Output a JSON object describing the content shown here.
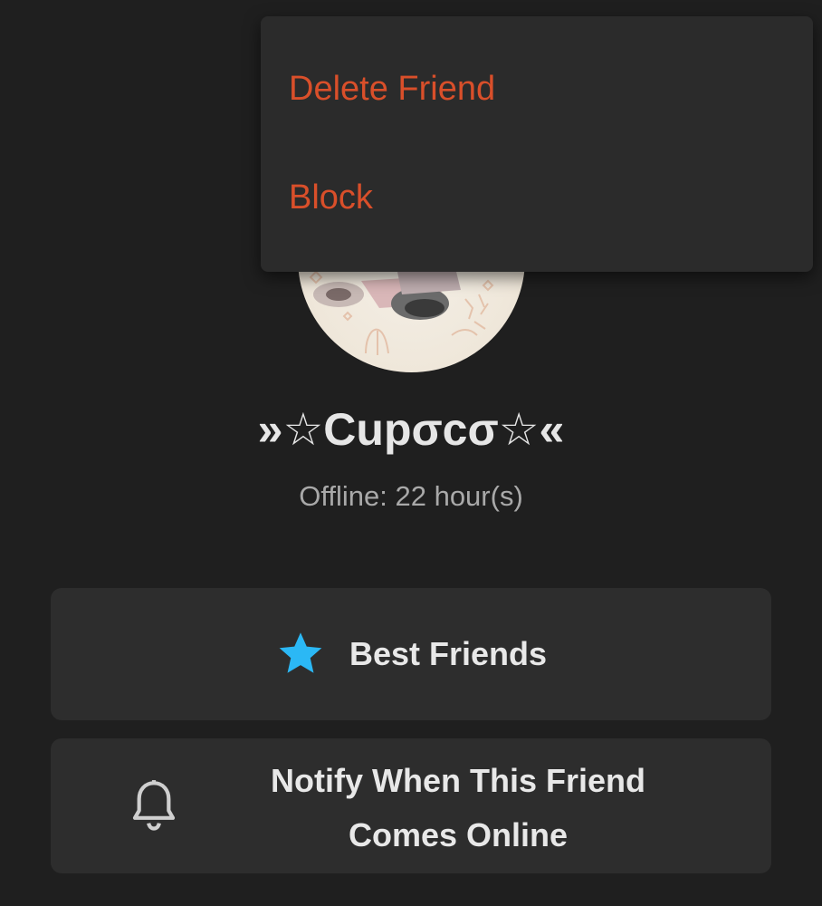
{
  "menu": {
    "items": [
      {
        "label": "Delete Friend"
      },
      {
        "label": "Block"
      }
    ],
    "text_color": "#d94f2a"
  },
  "profile": {
    "name": "»☆Cupσcσ☆«",
    "status": "Offline: 22 hour(s)"
  },
  "actions": {
    "best_friends_label": "Best Friends",
    "best_friends_icon": "star-icon",
    "best_friends_icon_color": "#2bb8f5",
    "notify_label_line1": "Notify When This Friend",
    "notify_label_line2": "Comes Online",
    "notify_icon": "bell-icon"
  }
}
